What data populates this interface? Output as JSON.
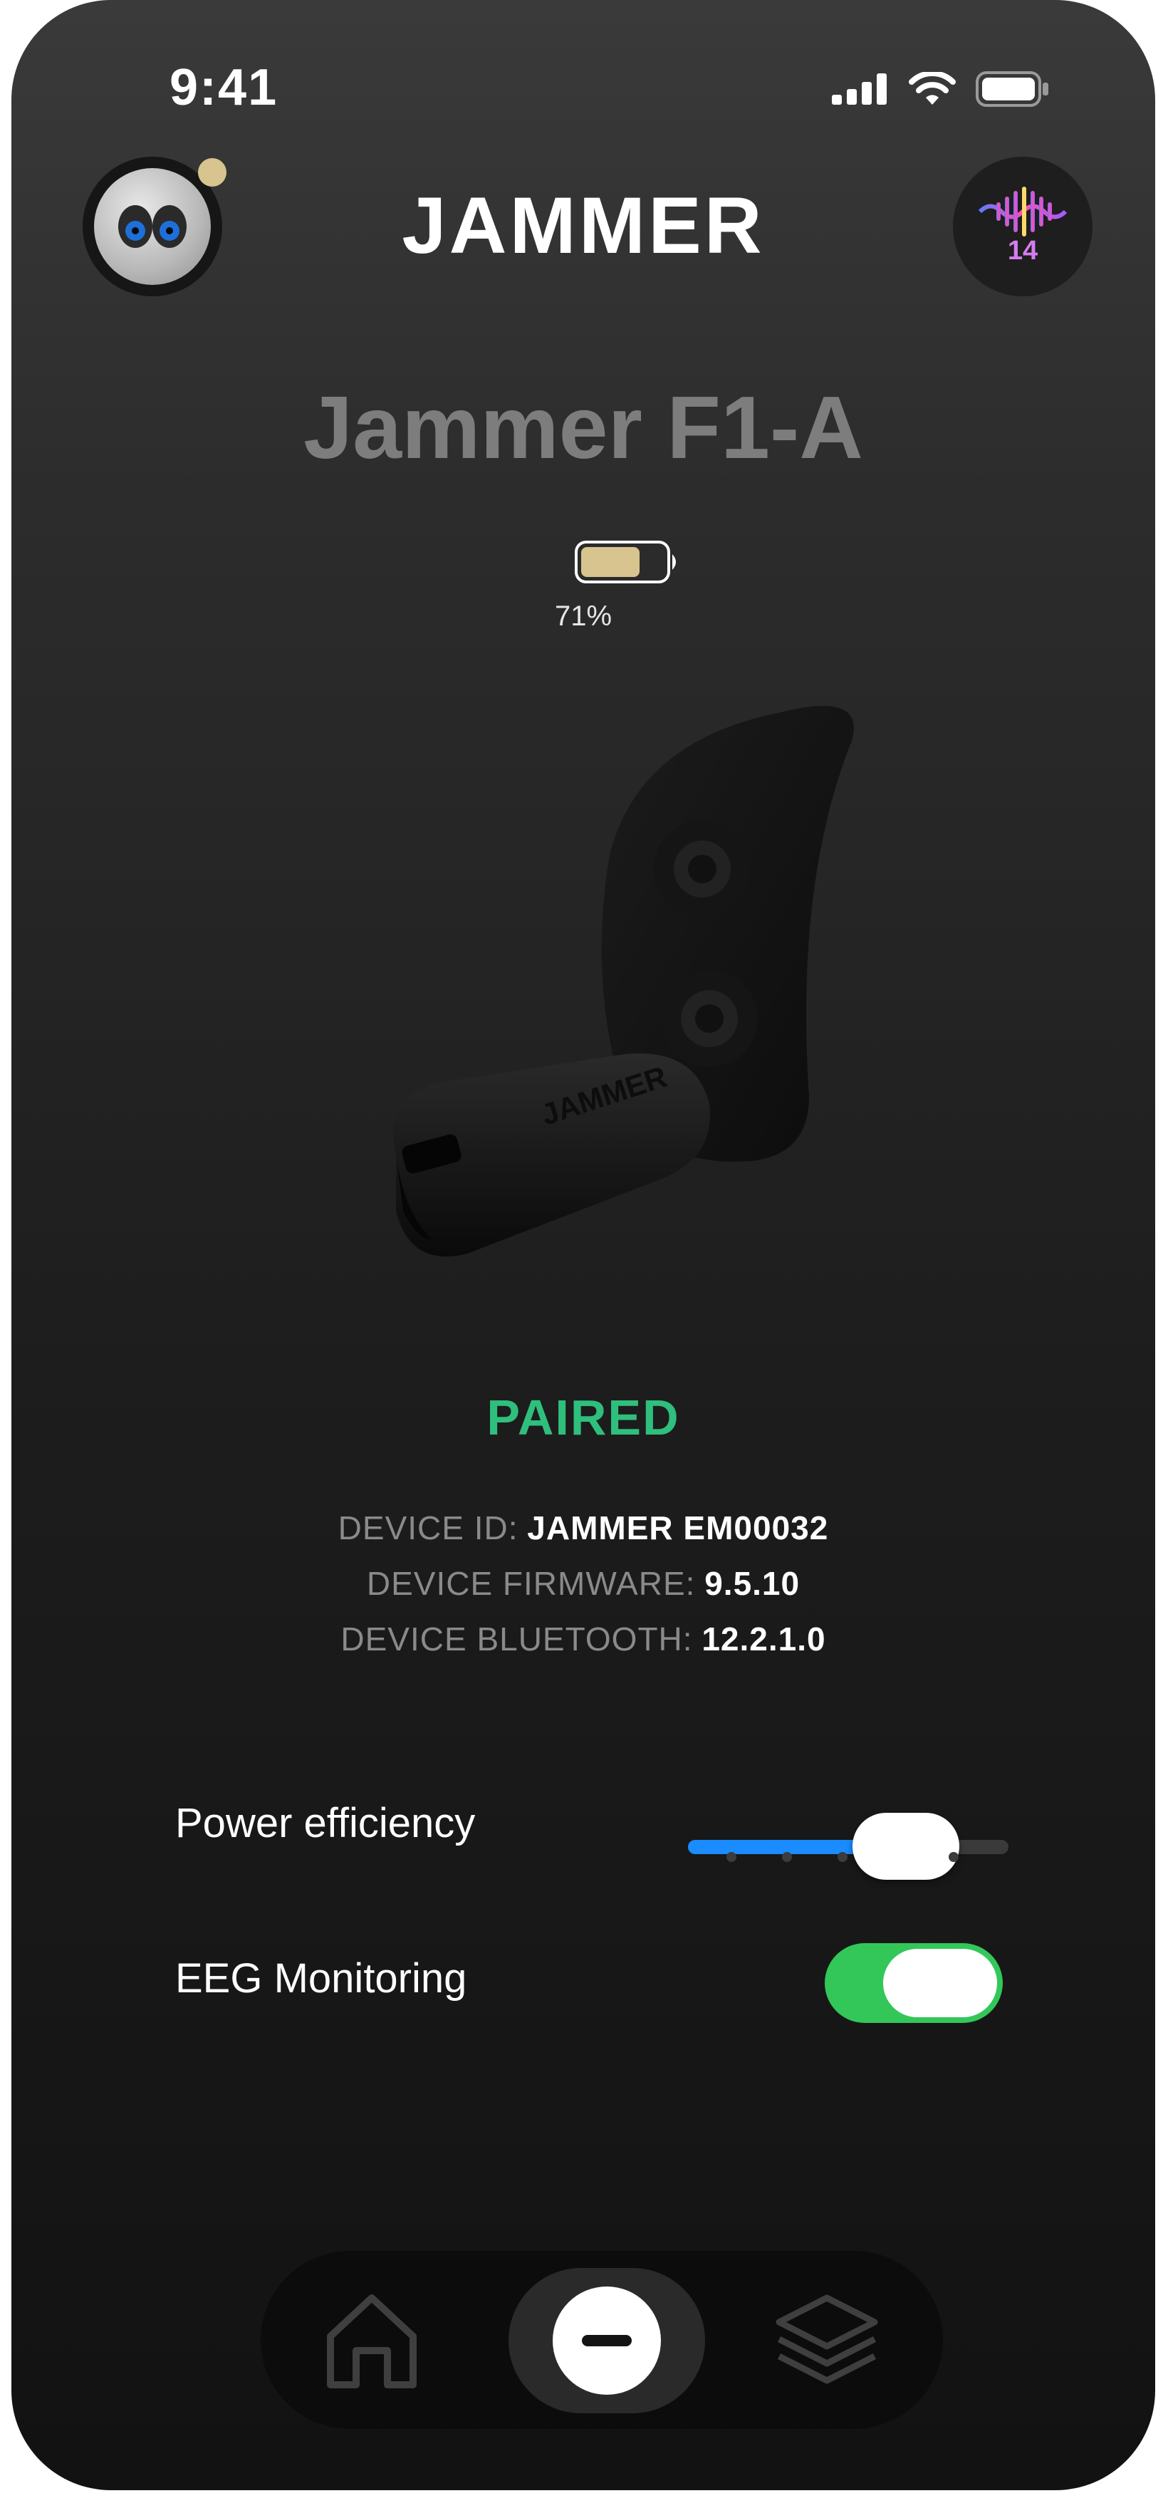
{
  "status_bar": {
    "time": "9:41"
  },
  "header": {
    "brand": "JAMMER",
    "notification_count": "14"
  },
  "device": {
    "name": "Jammer F1-A",
    "battery_percent": "71%",
    "battery_level": 0.71,
    "status": "PAIRED",
    "image_logo_text": "JAMMER",
    "info": [
      {
        "key": "DEVICE ID:",
        "value": "JAMMER EM00032"
      },
      {
        "key": "DEVICE FIRMWARE:",
        "value": "9.5.10"
      },
      {
        "key": "DEVICE BLUETOOTH:",
        "value": "12.2.1.0"
      }
    ]
  },
  "settings": {
    "power_efficiency": {
      "label": "Power efficiency",
      "level": 0.68
    },
    "eeg_monitoring": {
      "label": "EEG Monitoring",
      "enabled": true
    }
  },
  "tabs": [
    {
      "name": "home",
      "icon": "home-icon"
    },
    {
      "name": "center",
      "icon": "minus-icon",
      "active": true
    },
    {
      "name": "layers",
      "icon": "layers-icon"
    }
  ],
  "colors": {
    "accent_blue": "#1a8cff",
    "paired_green": "#2fbf7d",
    "toggle_green": "#33c75a",
    "battery_fill": "#d8c48f",
    "badge_purple": "#d67cf0"
  }
}
